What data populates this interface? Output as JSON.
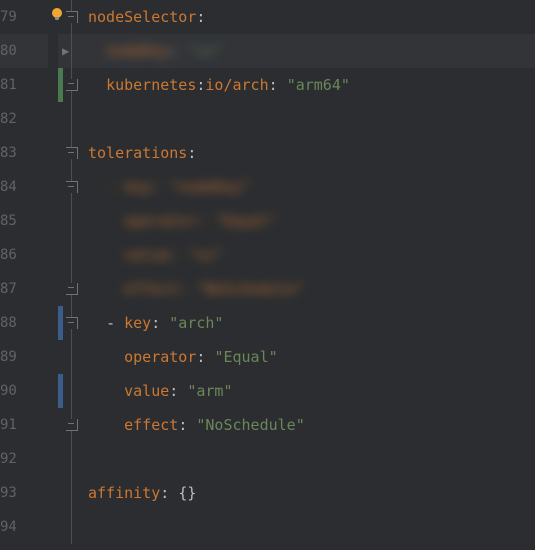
{
  "lines": {
    "l79": 79,
    "l80": 80,
    "l81": 81,
    "l82": 82,
    "l83": 83,
    "l84": 84,
    "l85": 85,
    "l86": 86,
    "l87": 87,
    "l88": 88,
    "l89": 89,
    "l90": 90,
    "l91": 91,
    "l92": 92,
    "l93": 93,
    "l94": 94
  },
  "code": {
    "nodeSelector_key": "nodeSelector",
    "nodeSelector_colon": ":",
    "line80_blur_key": "nodeKey",
    "line80_blur_val": "\"xx\"",
    "line81_key": "kubernetes",
    "line81_sep": ":",
    "line81_key2": "io/arch",
    "line81_colon": ": ",
    "line81_val": "\"arm64\"",
    "tolerations_key": "tolerations",
    "tolerations_colon": ":",
    "line84_blur": "- key: \"nodeKey\"",
    "line85_blur": "operator: \"Equal\"",
    "line86_blur": "value: \"xx\"",
    "line87_blur": "effect: \"NoSchedule\"",
    "line88_dash": "- ",
    "line88_key": "key",
    "line88_colon": ": ",
    "line88_val": "\"arch\"",
    "line89_key": "operator",
    "line89_colon": ": ",
    "line89_val": "\"Equal\"",
    "line90_key": "value",
    "line90_colon": ": ",
    "line90_val": "\"arm\"",
    "line91_key": "effect",
    "line91_colon": ": ",
    "line91_val": "\"NoSchedule\"",
    "affinity_key": "affinity",
    "affinity_colon": ": ",
    "affinity_val": "{}"
  }
}
